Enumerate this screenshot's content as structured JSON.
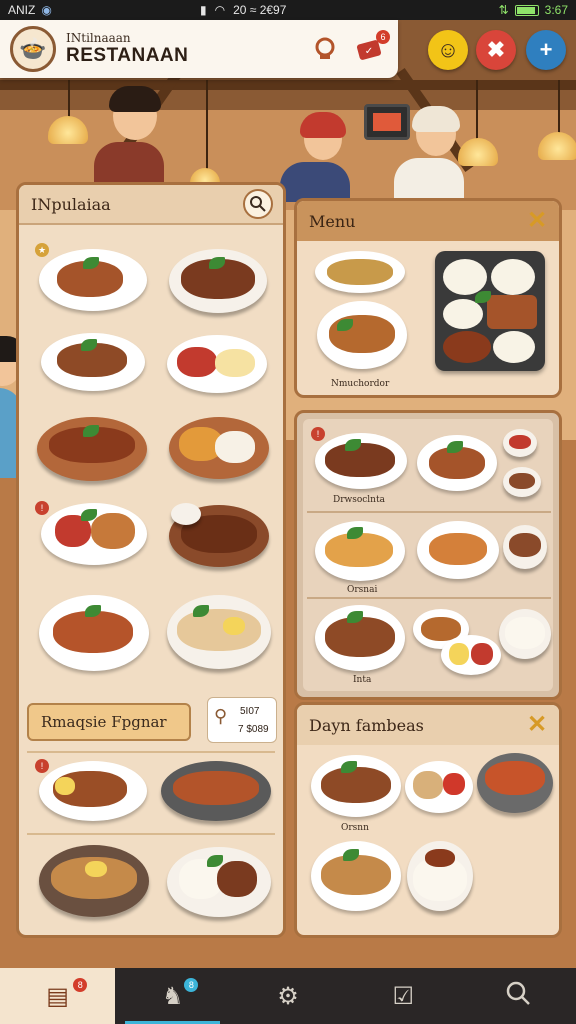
{
  "status_bar": {
    "carrier": "ANIZ",
    "center_time": "20 ≈ 2€97",
    "right_time": "3:67"
  },
  "app_bar": {
    "subtitle": "INtilnaaan",
    "title": "RESTANAAN",
    "cart_badge": "6"
  },
  "top_buttons": [
    {
      "icon": "smiley-icon",
      "color": "#f2c417"
    },
    {
      "icon": "tools-icon",
      "color": "#d9453a"
    },
    {
      "icon": "plus-icon",
      "color": "#2f7fbf",
      "label": "+"
    }
  ],
  "left_panel": {
    "title": "INpulaiaa",
    "promo_label": "Rmaqsie Fpgnar",
    "price_line1": "5I07",
    "price_line2": "7 $089"
  },
  "menu_panel": {
    "title": "Menu",
    "caption": "Nmuchordor"
  },
  "middle_panel": {
    "caption1": "Drwsoclnta",
    "caption2": "Orsnai",
    "caption3": "Inta"
  },
  "bottom_right_panel": {
    "title": "Dayn fambeas",
    "caption": "Orsnn"
  },
  "bottom_nav": {
    "items": [
      {
        "icon": "orders-icon",
        "badge": "8"
      },
      {
        "icon": "chef-icon",
        "badge": "8"
      },
      {
        "icon": "settings-icon"
      },
      {
        "icon": "checklist-icon"
      },
      {
        "icon": "search-icon"
      }
    ]
  },
  "colors": {
    "panel_bg": "#f1ddc4",
    "panel_border": "#a8703f",
    "accent_gold": "#d79a26",
    "nav_bg": "#2a2626"
  }
}
